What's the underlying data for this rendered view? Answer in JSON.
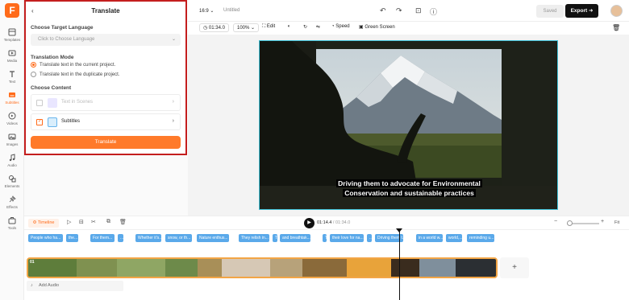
{
  "colors": {
    "accent": "#ff6b1a",
    "panel_border": "#c41e1e",
    "subtitle_clip": "#5aa9ea",
    "video_frame": "#3fc2d8"
  },
  "rail": {
    "logo": "F",
    "items": [
      {
        "label": "Templates",
        "icon": "template-icon"
      },
      {
        "label": "Media",
        "icon": "media-icon"
      },
      {
        "label": "Text",
        "icon": "text-icon"
      },
      {
        "label": "Subtitles",
        "icon": "subtitles-icon",
        "active": true
      },
      {
        "label": "Videos",
        "icon": "video-icon"
      },
      {
        "label": "Images",
        "icon": "image-icon"
      },
      {
        "label": "Audio",
        "icon": "audio-icon"
      },
      {
        "label": "Elements",
        "icon": "elements-icon"
      },
      {
        "label": "Effects",
        "icon": "effects-icon"
      },
      {
        "label": "Tools",
        "icon": "tools-icon"
      }
    ]
  },
  "panel": {
    "back": "‹",
    "title": "Translate",
    "target_language_heading": "Choose Target Language",
    "target_language_placeholder": "Click to Choose Language",
    "mode_heading": "Translation Mode",
    "mode_current": "Translate text in the current project.",
    "mode_duplicate": "Translate text in the duplicate project.",
    "content_heading": "Choose Content",
    "content_text_scenes": "Text in Scenes",
    "content_subtitles": "Subtitles",
    "translate_button": "Translate"
  },
  "topbar": {
    "ratio": "16:9",
    "ratio_caret": "⌄",
    "title": "Untitled",
    "saved": "Saved",
    "export": "Export"
  },
  "toolbar": {
    "duration": "01:34.0",
    "zoom": "100%",
    "edit": "Edit",
    "speed": "Speed",
    "green_screen": "Green Screen"
  },
  "video": {
    "subtitle_line1": "Driving them to advocate for Environmental",
    "subtitle_line2": "Conservation and sustainable practices"
  },
  "timeline": {
    "chip": "Timeline",
    "current_time": "01:14.4",
    "total_time": "/ 01:34.0",
    "fit": "Fit",
    "track_label": "01",
    "add_audio": "Add Audio",
    "add_clip": "+",
    "subtitle_clips": [
      {
        "text": "People who ha..."
      },
      {
        "text": "the..."
      },
      {
        "text": "For them..."
      },
      {
        "text": "..."
      },
      {
        "text": "Whether it's..."
      },
      {
        "text": "snow, or th..."
      },
      {
        "text": "Nature enthus..."
      },
      {
        "text": "They relish in..."
      },
      {
        "text": "T..."
      },
      {
        "text": "and breathtak..."
      },
      {
        "text": "T..."
      },
      {
        "text": "their love for na..."
      },
      {
        "text": "..."
      },
      {
        "text": "Driving them t..."
      },
      {
        "text": "in a world w..."
      },
      {
        "text": "world,..."
      },
      {
        "text": "reminding u..."
      }
    ]
  }
}
